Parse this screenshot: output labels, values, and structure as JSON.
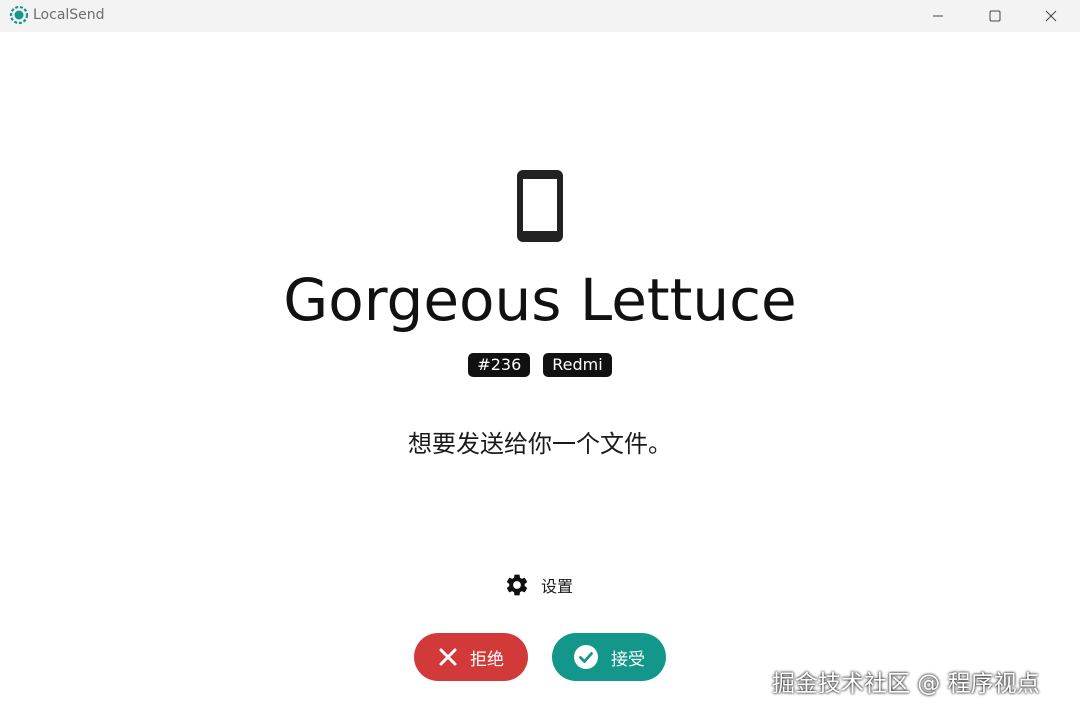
{
  "window": {
    "app_title": "LocalSend"
  },
  "sender": {
    "device_name": "Gorgeous Lettuce",
    "tags": [
      "#236",
      "Redmi"
    ],
    "device_icon": "smartphone-icon"
  },
  "message": "想要发送给你一个文件。",
  "settings": {
    "label": "设置",
    "icon": "gear-icon"
  },
  "actions": {
    "reject_label": "拒绝",
    "accept_label": "接受"
  },
  "colors": {
    "reject": "#d23a3a",
    "accept": "#13978a",
    "brand": "#13978a"
  },
  "watermark": "掘金技术社区 @ 程序视点"
}
